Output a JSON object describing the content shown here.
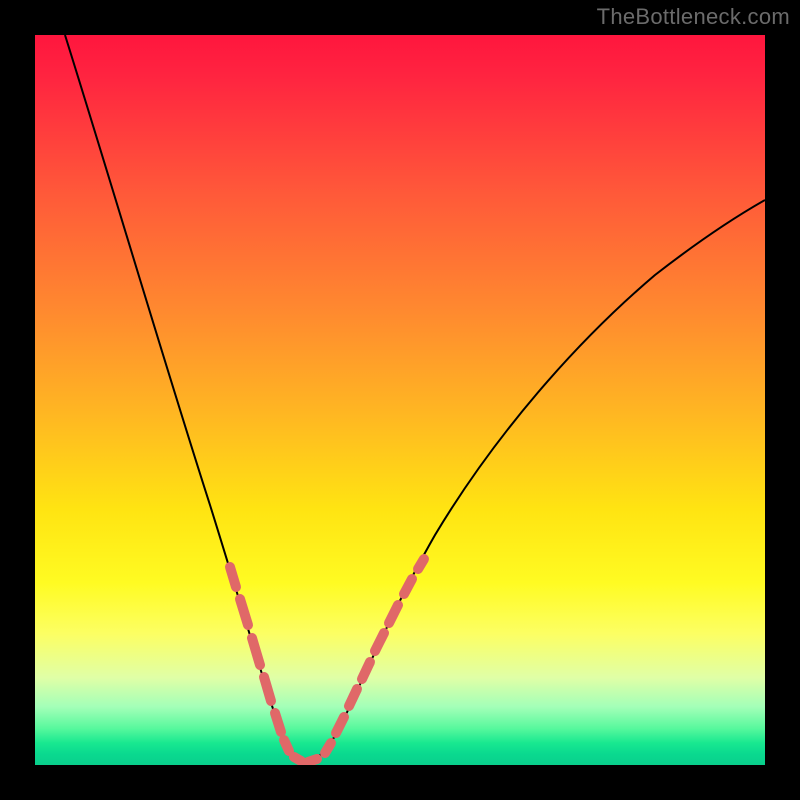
{
  "watermark": "TheBottleneck.com",
  "colors": {
    "frame": "#000000",
    "curve": "#000000",
    "dash": "#e06868",
    "gradient_top": "#ff163e",
    "gradient_bottom": "#09cf8c"
  },
  "chart_data": {
    "type": "line",
    "title": "",
    "xlabel": "",
    "ylabel": "",
    "xlim": [
      0,
      100
    ],
    "ylim": [
      0,
      100
    ],
    "x": [
      3,
      6,
      10,
      14,
      18,
      22,
      25,
      27,
      29,
      30,
      31,
      32,
      33,
      34,
      35,
      36,
      38,
      41,
      45,
      50,
      56,
      63,
      71,
      80,
      90,
      100
    ],
    "values": [
      100,
      89,
      75,
      61,
      47,
      33,
      22,
      15,
      9,
      6,
      4,
      2,
      1,
      1,
      2,
      4,
      8,
      14,
      22,
      31,
      40,
      48,
      55,
      62,
      68,
      73
    ],
    "annotations": {
      "dashed_segments_x_ranges": [
        [
          25,
          31
        ],
        [
          33,
          41
        ]
      ],
      "dashed_color": "#e06868"
    },
    "description": "A single black V-shaped curve on a rainbow vertical gradient background. Two stretches of the curve near the bottom are overlaid with thick salmon dashed strokes."
  }
}
